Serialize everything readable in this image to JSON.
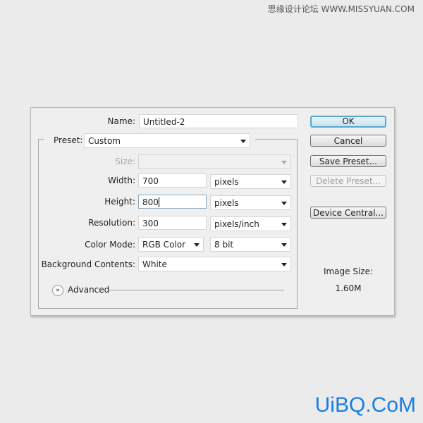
{
  "watermark_top": "思缘设计论坛 WWW.MISSYUAN.COM",
  "watermark_bottom": "UiBQ.CoM",
  "form": {
    "name_label": "Name:",
    "name_value": "Untitled-2",
    "preset_label": "Preset:",
    "preset_value": "Custom",
    "size_label": "Size:",
    "size_value": "",
    "width_label": "Width:",
    "width_value": "700",
    "width_unit": "pixels",
    "height_label": "Height:",
    "height_value": "800",
    "height_unit": "pixels",
    "resolution_label": "Resolution:",
    "resolution_value": "300",
    "resolution_unit": "pixels/inch",
    "color_mode_label": "Color Mode:",
    "color_mode_value": "RGB Color",
    "bit_depth": "8 bit",
    "background_label": "Background Contents:",
    "background_value": "White",
    "advanced_label": "Advanced"
  },
  "buttons": {
    "ok": "OK",
    "cancel": "Cancel",
    "save_preset": "Save Preset...",
    "delete_preset": "Delete Preset...",
    "device_central": "Device Central..."
  },
  "image_size": {
    "label": "Image Size:",
    "value": "1.60M"
  },
  "colors": {
    "accent": "#5aa8d0",
    "watermark": "#1a7fe0"
  }
}
